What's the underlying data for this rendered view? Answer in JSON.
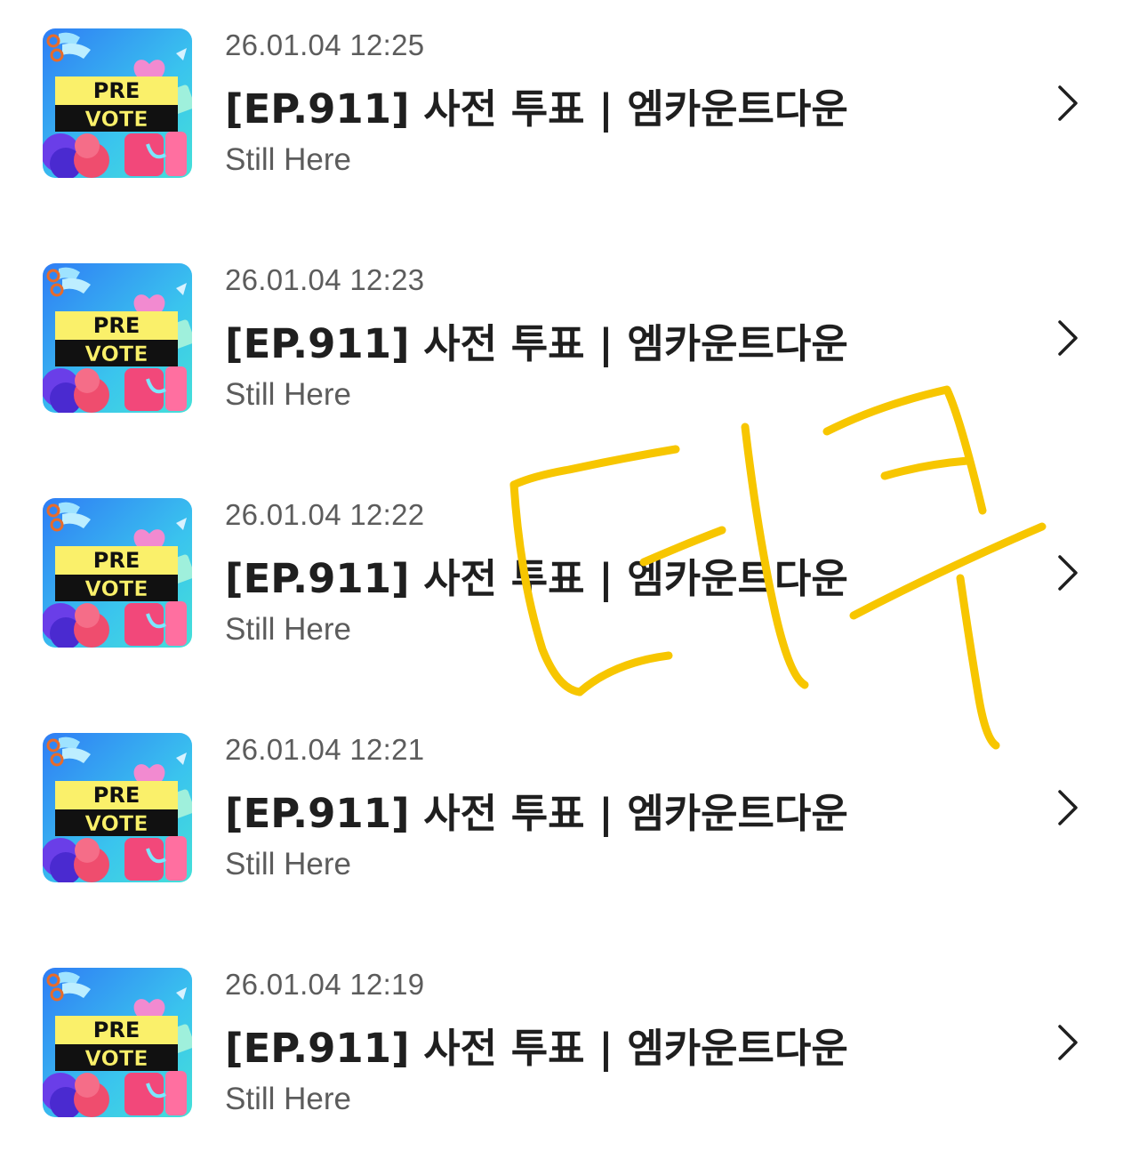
{
  "items": [
    {
      "timestamp": "26.01.04 12:25",
      "title": "[EP.911] 사전 투표 | 엠카운트다운",
      "subtitle": "Still Here",
      "thumb_label_top": "PRE",
      "thumb_label_bottom": "VOTE"
    },
    {
      "timestamp": "26.01.04 12:23",
      "title": "[EP.911] 사전 투표 | 엠카운트다운",
      "subtitle": "Still Here",
      "thumb_label_top": "PRE",
      "thumb_label_bottom": "VOTE"
    },
    {
      "timestamp": "26.01.04 12:22",
      "title": "[EP.911] 사전 투표 | 엠카운트다운",
      "subtitle": "Still Here",
      "thumb_label_top": "PRE",
      "thumb_label_bottom": "VOTE"
    },
    {
      "timestamp": "26.01.04 12:21",
      "title": "[EP.911] 사전 투표 | 엠카운트다운",
      "subtitle": "Still Here",
      "thumb_label_top": "PRE",
      "thumb_label_bottom": "VOTE"
    },
    {
      "timestamp": "26.01.04 12:19",
      "title": "[EP.911] 사전 투표 | 엠카운트다운",
      "subtitle": "Still Here",
      "thumb_label_top": "PRE",
      "thumb_label_bottom": "VOTE"
    }
  ],
  "icons": {
    "row_action": "chevron-right-icon"
  },
  "colors": {
    "text_primary": "#1f1f1f",
    "text_secondary": "#5c5c5c",
    "doodle_stroke": "#f7c600",
    "thumb_label_bg": "#faf06a"
  }
}
